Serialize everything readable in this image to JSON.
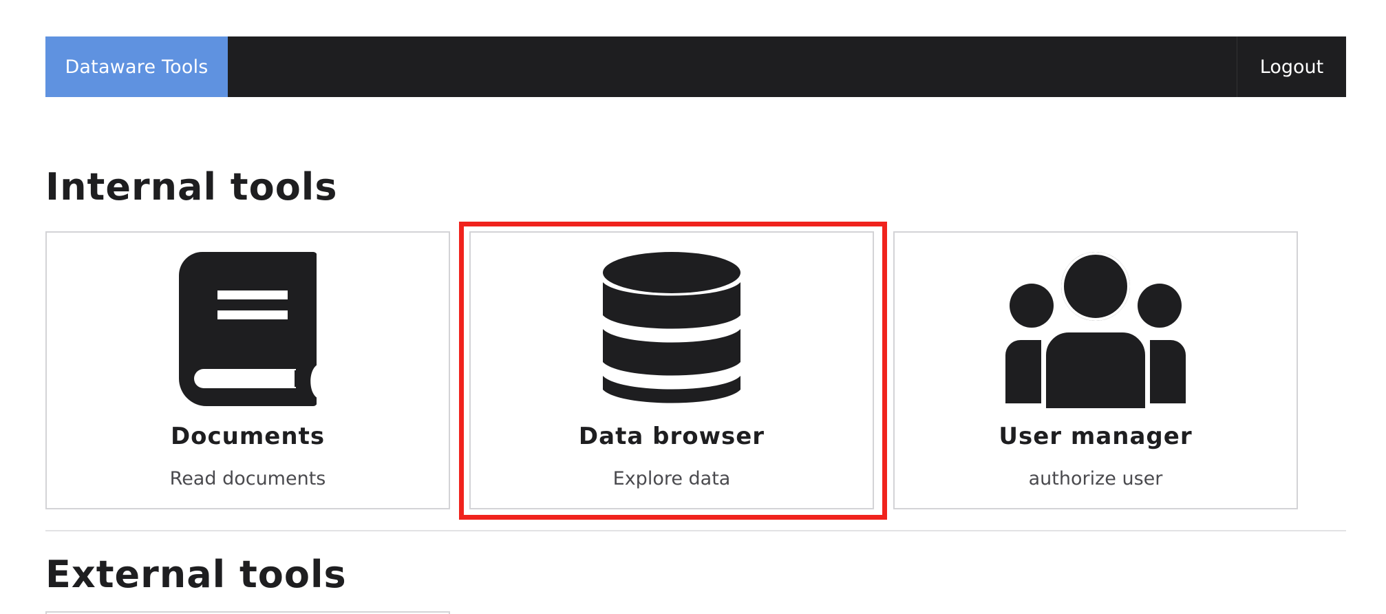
{
  "navbar": {
    "brand": "Dataware Tools",
    "logout": "Logout",
    "colors": {
      "background": "#1e1e20",
      "brand": "#5f92e0"
    }
  },
  "internal": {
    "title": "Internal tools",
    "cards": [
      {
        "title": "Documents",
        "description": "Read documents",
        "icon": "book-icon"
      },
      {
        "title": "Data browser",
        "description": "Explore data",
        "icon": "database-icon",
        "highlighted": true
      },
      {
        "title": "User manager",
        "description": "authorize user",
        "icon": "users-icon"
      }
    ]
  },
  "external": {
    "title": "External tools"
  },
  "highlight_color": "#f0231d"
}
